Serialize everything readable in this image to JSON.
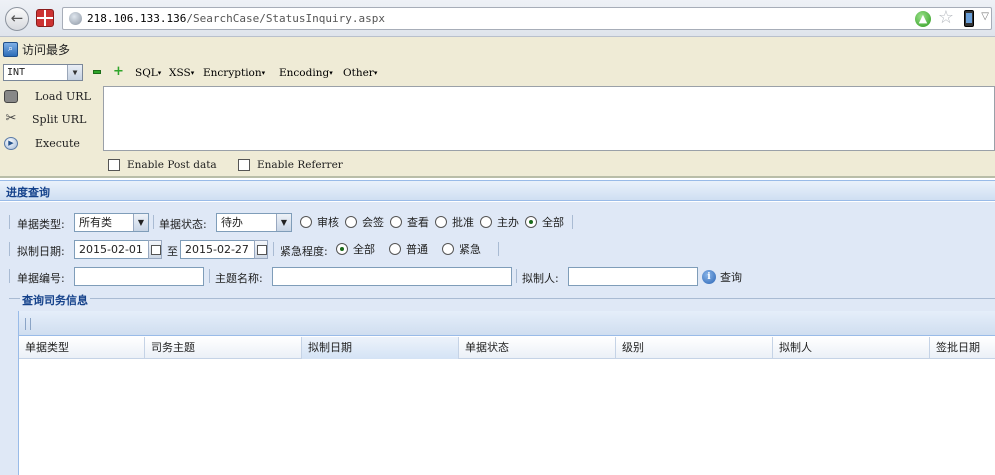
{
  "browser": {
    "back_glyph": "←",
    "url_host": "218.106.133.136",
    "url_path": "/SearchCase/StatusInquiry.aspx"
  },
  "hackbar": {
    "most_visited_label": "访问最多",
    "select_value": "INT",
    "menus": {
      "sql": "SQL",
      "xss": "XSS",
      "encryption": "Encryption",
      "encoding": "Encoding",
      "other": "Other"
    },
    "actions": {
      "load_url": "Load URL",
      "split_url": "Split URL",
      "execute": "Execute"
    },
    "checkboxes": {
      "post_data": "Enable Post data",
      "referrer": "Enable Referrer"
    }
  },
  "page": {
    "panel_title": "进度查询",
    "row1": {
      "doc_type_label": "单据类型:",
      "doc_type_value": "所有类",
      "doc_status_label": "单据状态:",
      "doc_status_value": "待办",
      "radios": [
        {
          "label": "审核",
          "checked": false
        },
        {
          "label": "会签",
          "checked": false
        },
        {
          "label": "查看",
          "checked": false
        },
        {
          "label": "批准",
          "checked": false
        },
        {
          "label": "主办",
          "checked": false
        },
        {
          "label": "全部",
          "checked": true
        }
      ]
    },
    "row2": {
      "date_label": "拟制日期:",
      "date_from": "2015-02-01",
      "date_to_sep": "至",
      "date_to": "2015-02-27",
      "urgency_label": "紧急程度:",
      "radios": [
        {
          "label": "全部",
          "checked": true
        },
        {
          "label": "普通",
          "checked": false
        },
        {
          "label": "紧急",
          "checked": false
        }
      ]
    },
    "row3": {
      "doc_no_label": "单据编号:",
      "subject_label": "主题名称:",
      "author_label": "拟制人:",
      "query_label": "查询"
    },
    "fieldset_legend": "查询司务信息",
    "grid_columns": [
      "单据类型",
      "司务主题",
      "拟制日期",
      "单据状态",
      "级别",
      "拟制人",
      "签批日期"
    ]
  }
}
